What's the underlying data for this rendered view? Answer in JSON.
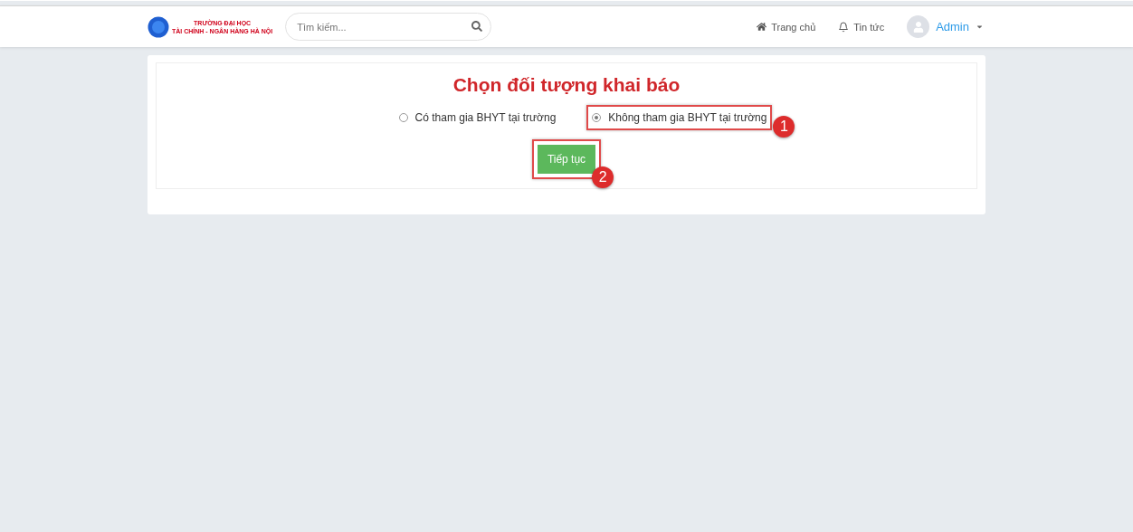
{
  "header": {
    "logo": {
      "line_1": "TRƯỜNG ĐẠI HỌC",
      "line_2": "TÀI CHÍNH - NGÂN HÀNG HÀ NỘI"
    },
    "search": {
      "placeholder": "Tìm kiếm..."
    },
    "nav": [
      {
        "kind": "home",
        "label": "Trang chủ"
      },
      {
        "kind": "bell",
        "label": "Tin tức"
      }
    ],
    "user": {
      "name": "Admin"
    }
  },
  "form": {
    "title": "Chọn đối tượng khai báo",
    "options": [
      {
        "label": "Có tham gia BHYT tại trường",
        "selected": false
      },
      {
        "label": "Không tham gia BHYT tại trường",
        "selected": true,
        "annotation": "1"
      }
    ],
    "button": {
      "label": "Tiếp tục",
      "annotation": "2"
    }
  }
}
